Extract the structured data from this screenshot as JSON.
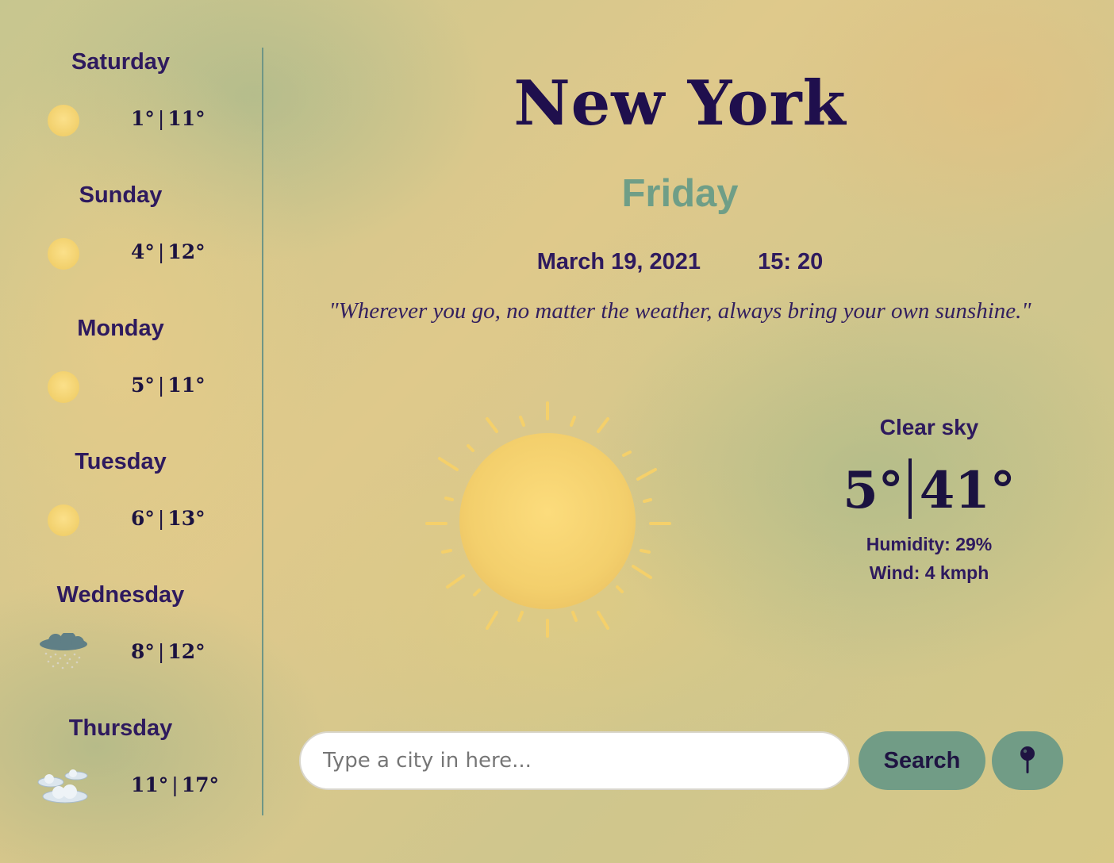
{
  "forecast": [
    {
      "day": "Saturday",
      "low": "1°",
      "high": "11°",
      "icon": "sun-icon"
    },
    {
      "day": "Sunday",
      "low": "4°",
      "high": "12°",
      "icon": "sun-icon"
    },
    {
      "day": "Monday",
      "low": "5°",
      "high": "11°",
      "icon": "sun-icon"
    },
    {
      "day": "Tuesday",
      "low": "6°",
      "high": "13°",
      "icon": "sun-icon"
    },
    {
      "day": "Wednesday",
      "low": "8°",
      "high": "12°",
      "icon": "rain-cloud-icon"
    },
    {
      "day": "Thursday",
      "low": "11°",
      "high": "17°",
      "icon": "clouds-icon"
    }
  ],
  "current": {
    "city": "New York",
    "weekday": "Friday",
    "date": "March 19, 2021",
    "time": "15: 20",
    "quote": "\"Wherever you go, no matter the weather, always bring your own sunshine.\"",
    "description": "Clear sky",
    "temp_c": "5°",
    "temp_f": "41°",
    "humidity": "Humidity: 29%",
    "wind": "Wind: 4 kmph",
    "icon": "sun-icon"
  },
  "search": {
    "placeholder": "Type a city in here...",
    "value": "",
    "button_label": "Search",
    "location_icon": "location-pin-icon"
  },
  "colors": {
    "title": "#1f0f4d",
    "accent": "#6f9e87",
    "button": "#719c86",
    "text": "#2e1a5e"
  }
}
